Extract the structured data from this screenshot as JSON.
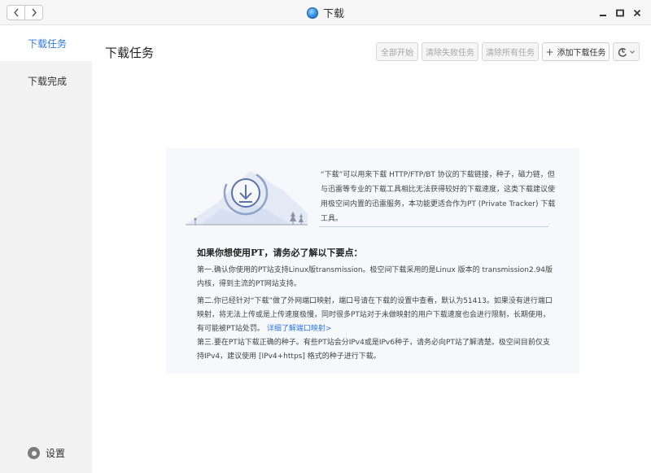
{
  "window": {
    "title": "下载"
  },
  "sidebar": {
    "items": [
      {
        "label": "下载任务",
        "active": true
      },
      {
        "label": "下载完成",
        "active": false
      }
    ],
    "settings_label": "设置"
  },
  "main": {
    "title": "下载任务",
    "toolbar": {
      "start_all": "全部开始",
      "clear_failed": "清除失败任务",
      "clear_all": "清除所有任务",
      "add_task": "添加下载任务"
    }
  },
  "info": {
    "intro": "“下载”可以用来下载 HTTP/FTP/BT 协议的下载链接，种子，磁力链，但与迅雷等专业的下载工具相比无法获得较好的下载速度，这类下载建议使用极空间内置的迅雷服务，本功能更适合作为PT (Private Tracker) 下载工具。",
    "heading": "如果你想使用PT，请务必了解以下要点：",
    "point1": "第一.确认你使用的PT站支持Linux版transmission。极空间下载采用的是Linux 版本的 transmission2.94版内核，得到主流的PT网站支持。",
    "point2": "第二.你已经针对“下载”做了外网端口映射，端口号请在下载的设置中查看，默认为51413。如果没有进行端口映射，将无法上传或是上传速度极慢，同时很多PT站对于未做映射的用户下载速度也会进行限制，长期使用，有可能被PT站处罚。",
    "point2_link": "详细了解端口映射>",
    "point3": "第三.要在PT站下载正确的种子。有些PT站会分IPv4或是IPv6种子，请务必向PT站了解清楚。极空间目前仅支持IPv4，建议使用 [IPv4+https] 格式的种子进行下载。"
  },
  "colors": {
    "accent": "#2f78e4",
    "sidebar_bg": "#f2f2f2",
    "panel_bg": "#f6f8fc"
  }
}
